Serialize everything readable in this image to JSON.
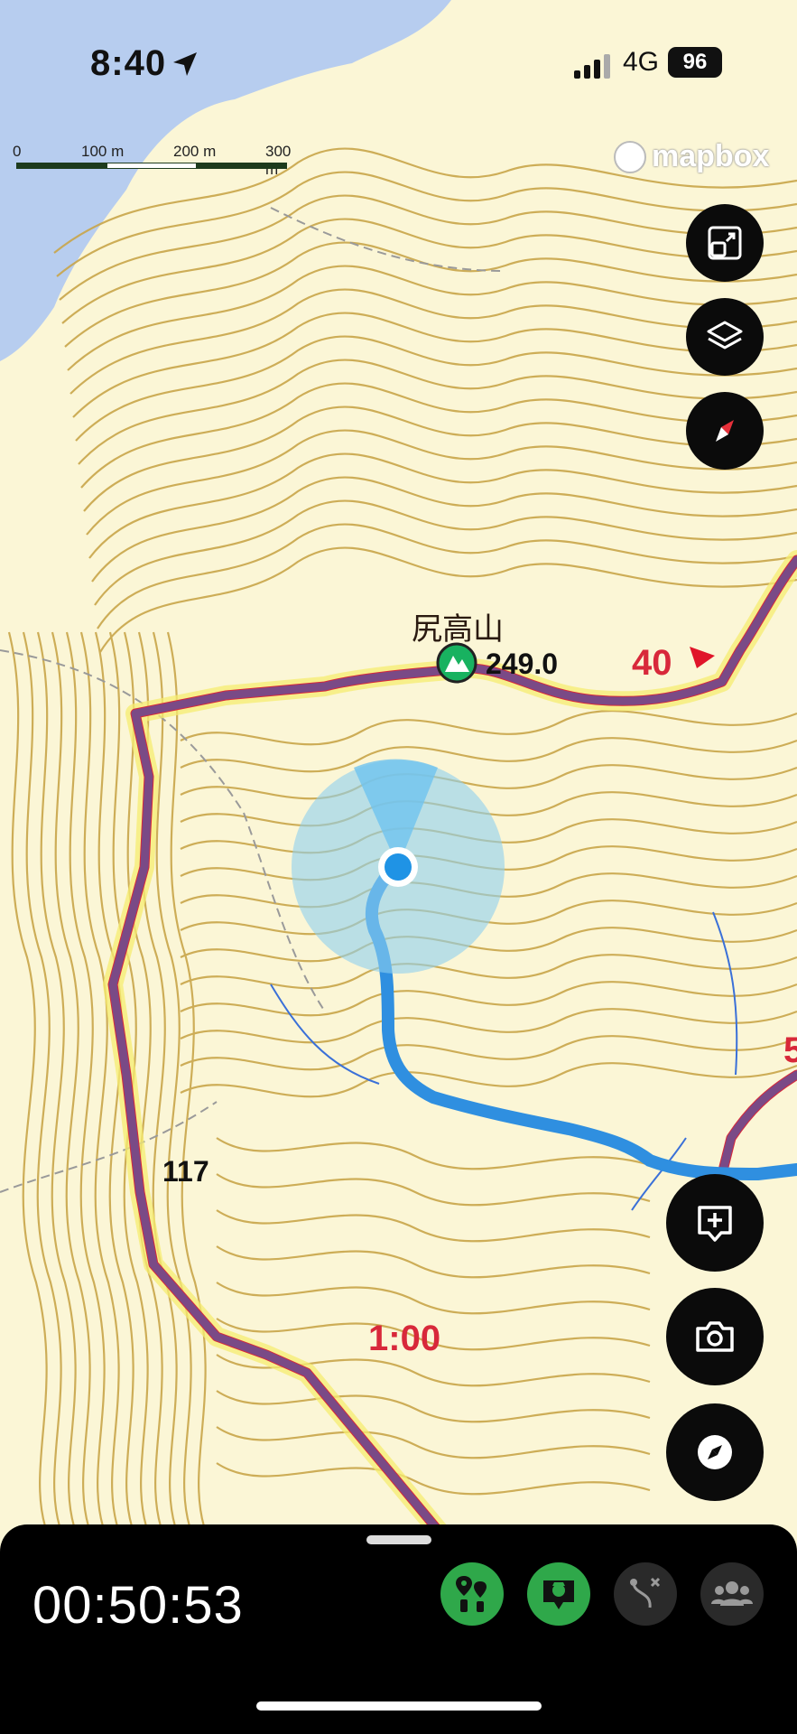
{
  "status_bar": {
    "time": "8:40",
    "network": "4G",
    "battery": "96"
  },
  "scale_bar": {
    "labels": [
      "0",
      "100 m",
      "200 m",
      "300 m"
    ]
  },
  "attribution": "mapbox",
  "map": {
    "peak_name": "尻高山",
    "peak_elevation": "249.0",
    "course_time_1": "40",
    "course_time_2": "1:00",
    "course_time_3": "5",
    "spot_elevation": "117",
    "route_color": "#7a4a86",
    "track_color": "#2f8fe0",
    "contour_color": "#c9a64a"
  },
  "right_controls": [
    {
      "name": "fit-screen-icon"
    },
    {
      "name": "layers-icon"
    },
    {
      "name": "north-compass-icon"
    }
  ],
  "lower_controls": [
    {
      "name": "add-memo-icon"
    },
    {
      "name": "camera-icon"
    },
    {
      "name": "navigation-compass-icon"
    }
  ],
  "bottom_bar": {
    "elapsed_time": "00:50:53",
    "buttons": [
      {
        "name": "waypoint-pins-icon",
        "active": true
      },
      {
        "name": "ranger-chat-icon",
        "active": true
      },
      {
        "name": "route-off-icon",
        "active": false
      },
      {
        "name": "group-members-icon",
        "active": false
      }
    ],
    "active_color": "#2fa84a"
  }
}
